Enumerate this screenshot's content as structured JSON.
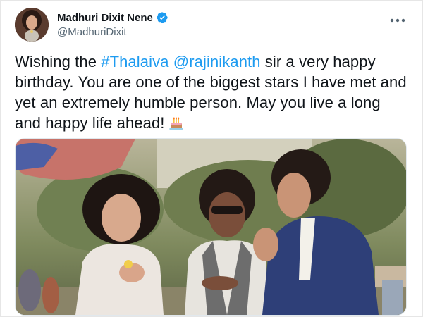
{
  "tweet": {
    "author": {
      "display_name": "Madhuri Dixit Nene",
      "handle": "@MadhuriDixit",
      "verified": true,
      "avatar": "avatar-photo"
    },
    "text": {
      "segments": [
        {
          "type": "text",
          "value": "Wishing the "
        },
        {
          "type": "hashtag",
          "value": "#Thalaiva"
        },
        {
          "type": "text",
          "value": " "
        },
        {
          "type": "mention",
          "value": "@rajinikanth"
        },
        {
          "type": "text",
          "value": " sir a very happy birthday. You are one of the biggest stars I have met and yet an extremely humble person. May you live a long and happy life ahead!"
        }
      ],
      "emoji": "birthday-cake-icon"
    },
    "media": {
      "kind": "photo",
      "description_icon": "photo"
    }
  },
  "icons": {
    "verified": "verified-badge-icon",
    "more": "more-options-icon"
  },
  "colors": {
    "link": "#1d9bf0",
    "text": "#0f1419",
    "secondary": "#536471",
    "verified": "#1d9bf0"
  }
}
